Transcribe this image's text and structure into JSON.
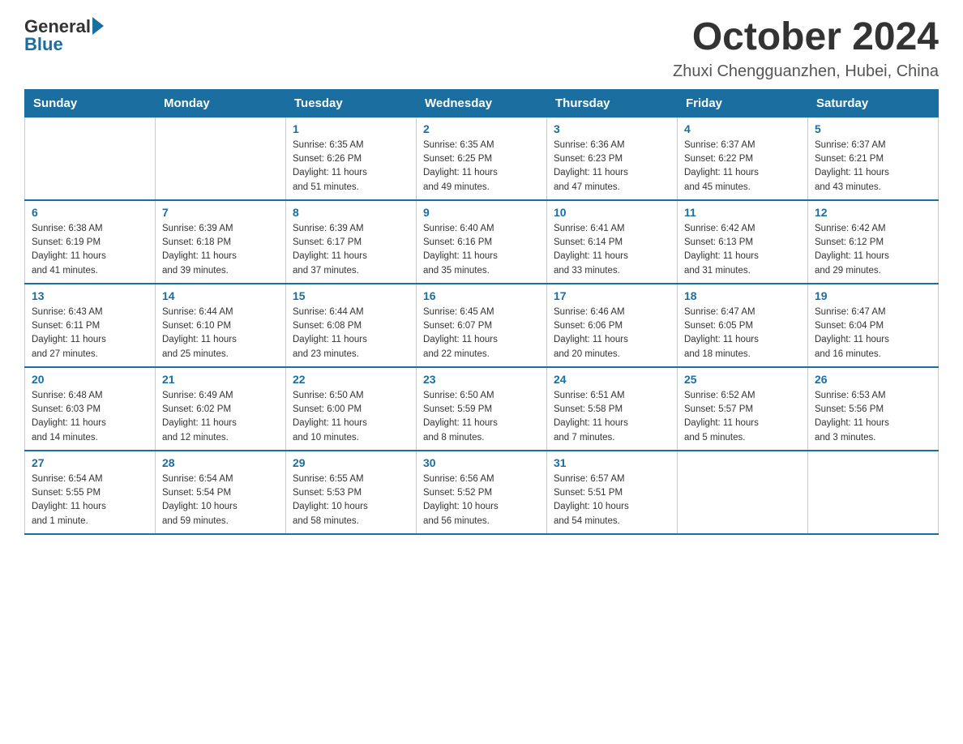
{
  "header": {
    "logo_general": "General",
    "logo_blue": "Blue",
    "month_title": "October 2024",
    "subtitle": "Zhuxi Chengguanzhen, Hubei, China"
  },
  "days_of_week": [
    "Sunday",
    "Monday",
    "Tuesday",
    "Wednesday",
    "Thursday",
    "Friday",
    "Saturday"
  ],
  "weeks": [
    [
      {
        "day": "",
        "info": ""
      },
      {
        "day": "",
        "info": ""
      },
      {
        "day": "1",
        "info": "Sunrise: 6:35 AM\nSunset: 6:26 PM\nDaylight: 11 hours\nand 51 minutes."
      },
      {
        "day": "2",
        "info": "Sunrise: 6:35 AM\nSunset: 6:25 PM\nDaylight: 11 hours\nand 49 minutes."
      },
      {
        "day": "3",
        "info": "Sunrise: 6:36 AM\nSunset: 6:23 PM\nDaylight: 11 hours\nand 47 minutes."
      },
      {
        "day": "4",
        "info": "Sunrise: 6:37 AM\nSunset: 6:22 PM\nDaylight: 11 hours\nand 45 minutes."
      },
      {
        "day": "5",
        "info": "Sunrise: 6:37 AM\nSunset: 6:21 PM\nDaylight: 11 hours\nand 43 minutes."
      }
    ],
    [
      {
        "day": "6",
        "info": "Sunrise: 6:38 AM\nSunset: 6:19 PM\nDaylight: 11 hours\nand 41 minutes."
      },
      {
        "day": "7",
        "info": "Sunrise: 6:39 AM\nSunset: 6:18 PM\nDaylight: 11 hours\nand 39 minutes."
      },
      {
        "day": "8",
        "info": "Sunrise: 6:39 AM\nSunset: 6:17 PM\nDaylight: 11 hours\nand 37 minutes."
      },
      {
        "day": "9",
        "info": "Sunrise: 6:40 AM\nSunset: 6:16 PM\nDaylight: 11 hours\nand 35 minutes."
      },
      {
        "day": "10",
        "info": "Sunrise: 6:41 AM\nSunset: 6:14 PM\nDaylight: 11 hours\nand 33 minutes."
      },
      {
        "day": "11",
        "info": "Sunrise: 6:42 AM\nSunset: 6:13 PM\nDaylight: 11 hours\nand 31 minutes."
      },
      {
        "day": "12",
        "info": "Sunrise: 6:42 AM\nSunset: 6:12 PM\nDaylight: 11 hours\nand 29 minutes."
      }
    ],
    [
      {
        "day": "13",
        "info": "Sunrise: 6:43 AM\nSunset: 6:11 PM\nDaylight: 11 hours\nand 27 minutes."
      },
      {
        "day": "14",
        "info": "Sunrise: 6:44 AM\nSunset: 6:10 PM\nDaylight: 11 hours\nand 25 minutes."
      },
      {
        "day": "15",
        "info": "Sunrise: 6:44 AM\nSunset: 6:08 PM\nDaylight: 11 hours\nand 23 minutes."
      },
      {
        "day": "16",
        "info": "Sunrise: 6:45 AM\nSunset: 6:07 PM\nDaylight: 11 hours\nand 22 minutes."
      },
      {
        "day": "17",
        "info": "Sunrise: 6:46 AM\nSunset: 6:06 PM\nDaylight: 11 hours\nand 20 minutes."
      },
      {
        "day": "18",
        "info": "Sunrise: 6:47 AM\nSunset: 6:05 PM\nDaylight: 11 hours\nand 18 minutes."
      },
      {
        "day": "19",
        "info": "Sunrise: 6:47 AM\nSunset: 6:04 PM\nDaylight: 11 hours\nand 16 minutes."
      }
    ],
    [
      {
        "day": "20",
        "info": "Sunrise: 6:48 AM\nSunset: 6:03 PM\nDaylight: 11 hours\nand 14 minutes."
      },
      {
        "day": "21",
        "info": "Sunrise: 6:49 AM\nSunset: 6:02 PM\nDaylight: 11 hours\nand 12 minutes."
      },
      {
        "day": "22",
        "info": "Sunrise: 6:50 AM\nSunset: 6:00 PM\nDaylight: 11 hours\nand 10 minutes."
      },
      {
        "day": "23",
        "info": "Sunrise: 6:50 AM\nSunset: 5:59 PM\nDaylight: 11 hours\nand 8 minutes."
      },
      {
        "day": "24",
        "info": "Sunrise: 6:51 AM\nSunset: 5:58 PM\nDaylight: 11 hours\nand 7 minutes."
      },
      {
        "day": "25",
        "info": "Sunrise: 6:52 AM\nSunset: 5:57 PM\nDaylight: 11 hours\nand 5 minutes."
      },
      {
        "day": "26",
        "info": "Sunrise: 6:53 AM\nSunset: 5:56 PM\nDaylight: 11 hours\nand 3 minutes."
      }
    ],
    [
      {
        "day": "27",
        "info": "Sunrise: 6:54 AM\nSunset: 5:55 PM\nDaylight: 11 hours\nand 1 minute."
      },
      {
        "day": "28",
        "info": "Sunrise: 6:54 AM\nSunset: 5:54 PM\nDaylight: 10 hours\nand 59 minutes."
      },
      {
        "day": "29",
        "info": "Sunrise: 6:55 AM\nSunset: 5:53 PM\nDaylight: 10 hours\nand 58 minutes."
      },
      {
        "day": "30",
        "info": "Sunrise: 6:56 AM\nSunset: 5:52 PM\nDaylight: 10 hours\nand 56 minutes."
      },
      {
        "day": "31",
        "info": "Sunrise: 6:57 AM\nSunset: 5:51 PM\nDaylight: 10 hours\nand 54 minutes."
      },
      {
        "day": "",
        "info": ""
      },
      {
        "day": "",
        "info": ""
      }
    ]
  ]
}
